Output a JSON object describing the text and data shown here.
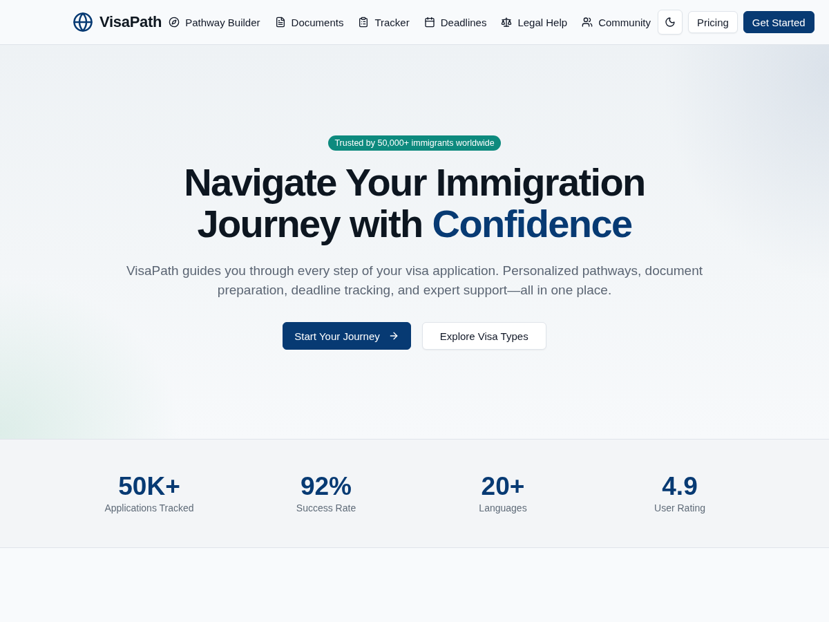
{
  "header": {
    "logo": "VisaPath",
    "nav": [
      {
        "label": "Pathway Builder"
      },
      {
        "label": "Documents"
      },
      {
        "label": "Tracker"
      },
      {
        "label": "Deadlines"
      },
      {
        "label": "Legal Help"
      },
      {
        "label": "Community"
      }
    ],
    "buttons": [
      {
        "label": "Pricing",
        "kind": "outline"
      },
      {
        "label": "Get Started",
        "kind": "primary"
      }
    ]
  },
  "hero": {
    "badge": "Trusted by 50,000+ immigrants worldwide",
    "title": "Navigate Your Immigration Journey with",
    "title_highlight": "Confidence",
    "subtitle": "VisaPath guides you through every step of your visa application. Personalized pathways, document preparation, deadline tracking, and expert support—all in one place.",
    "buttons": [
      {
        "label": "Start Your Journey",
        "kind": "primary"
      },
      {
        "label": "Explore Visa Types",
        "kind": "outline"
      }
    ]
  },
  "stats": [
    {
      "value": "50K+",
      "label": "Applications Tracked"
    },
    {
      "value": "92%",
      "label": "Success Rate"
    },
    {
      "value": "20+",
      "label": "Languages"
    },
    {
      "value": "4.9",
      "label": "User Rating"
    }
  ]
}
